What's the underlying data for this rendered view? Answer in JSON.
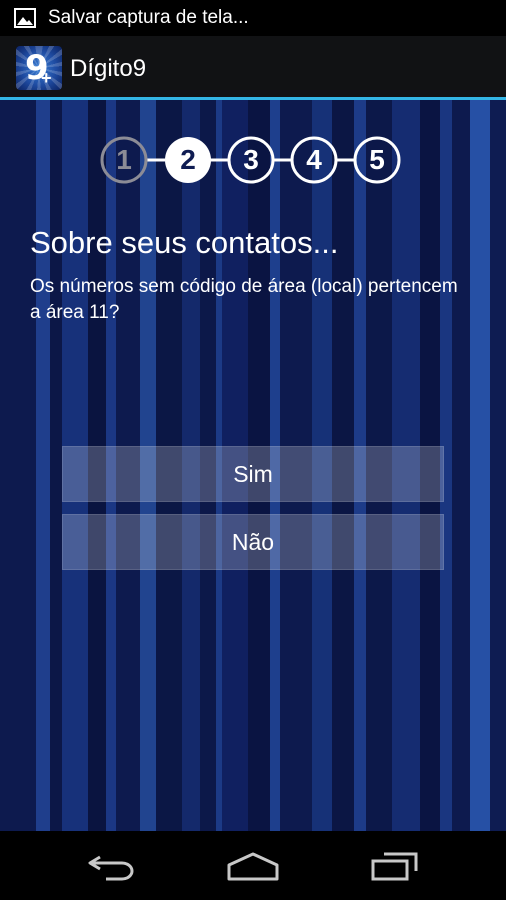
{
  "status_bar": {
    "notification_text": "Salvar captura de tela...",
    "icon": "image-icon"
  },
  "action_bar": {
    "app_title": "Dígito9",
    "app_icon": "app-icon-nine-plus",
    "app_icon_glyph": "9",
    "app_icon_plus": "+",
    "accent_color": "#33b5e5"
  },
  "wizard": {
    "steps": [
      "1",
      "2",
      "3",
      "4",
      "5"
    ],
    "current_step": 2,
    "heading": "Sobre seus contatos...",
    "question": "Os números sem código de área (local) pertencem a área 11?",
    "buttons": {
      "yes_label": "Sim",
      "no_label": "Não"
    }
  },
  "navigation": {
    "back": "back-icon",
    "home": "home-icon",
    "recents": "recent-apps-icon"
  }
}
